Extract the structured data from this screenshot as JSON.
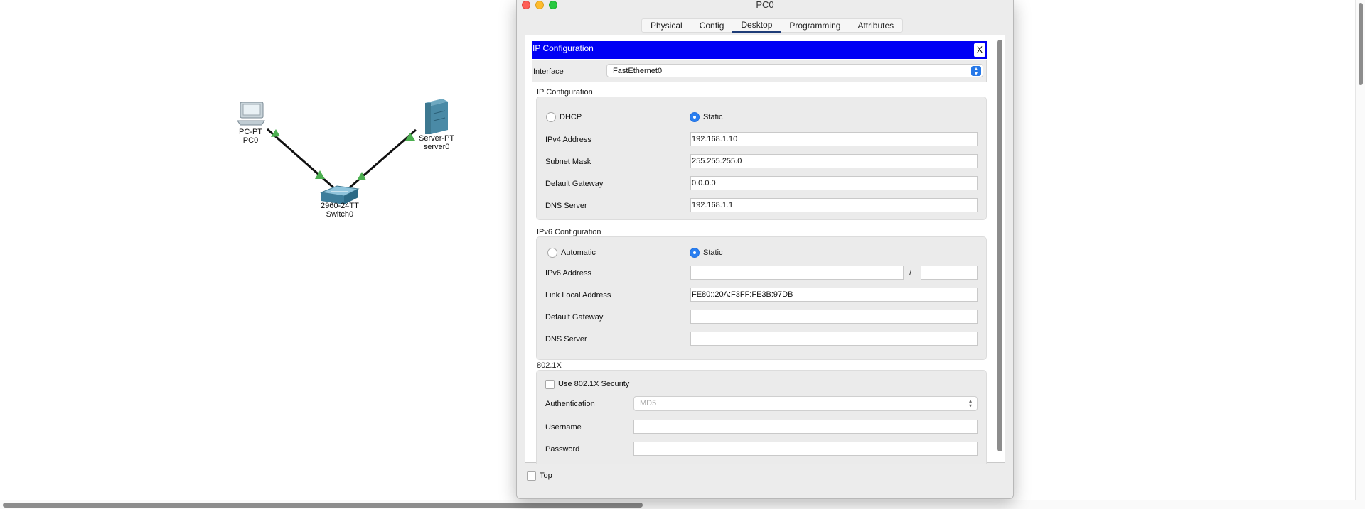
{
  "window": {
    "title": "PC0"
  },
  "tabs": [
    "Physical",
    "Config",
    "Desktop",
    "Programming",
    "Attributes"
  ],
  "network": {
    "pc": {
      "model": "PC-PT",
      "name": "PC0"
    },
    "switch": {
      "model": "2960-24TT",
      "name": "Switch0"
    },
    "server": {
      "model": "Server-PT",
      "name": "server0"
    }
  },
  "ip_config": {
    "header_title": "IP Configuration",
    "close_label": "X",
    "interface_label": "Interface",
    "interface_value": "FastEthernet0",
    "ipv4_section": "IP Configuration",
    "dhcp_label": "DHCP",
    "static_label": "Static",
    "ipv4_address_label": "IPv4 Address",
    "ipv4_address": "192.168.1.10",
    "subnet_mask_label": "Subnet Mask",
    "subnet_mask": "255.255.255.0",
    "default_gateway_label": "Default Gateway",
    "default_gateway": "0.0.0.0",
    "dns_server_label": "DNS Server",
    "dns_server": "192.168.1.1",
    "ipv6_section": "IPv6 Configuration",
    "automatic_label": "Automatic",
    "ipv6_static_label": "Static",
    "ipv6_address_label": "IPv6 Address",
    "ipv6_address": "",
    "prefix_sep": "/",
    "ipv6_prefix": "",
    "link_local_label": "Link Local Address",
    "link_local": "FE80::20A:F3FF:FE3B:97DB",
    "ipv6_gateway_label": "Default Gateway",
    "ipv6_gateway": "",
    "ipv6_dns_label": "DNS Server",
    "ipv6_dns": "",
    "dot1x_section": "802.1X",
    "use_8021x_label": "Use 802.1X Security",
    "authentication_label": "Authentication",
    "authentication_value": "MD5",
    "username_label": "Username",
    "username": "",
    "password_label": "Password",
    "password": ""
  },
  "footer": {
    "top_label": "Top"
  },
  "colors": {
    "header_bg": "#0000f5",
    "accent": "#2a7ff0",
    "active_tab": "#1e3c78"
  }
}
